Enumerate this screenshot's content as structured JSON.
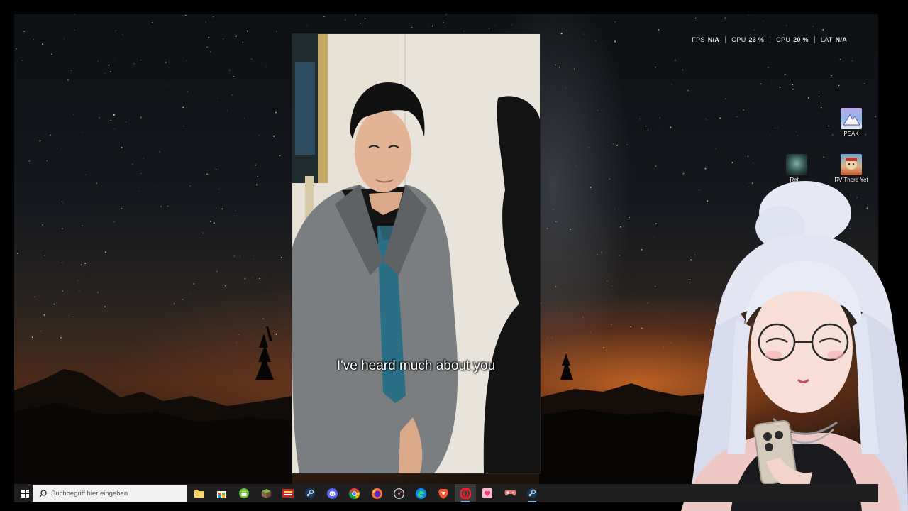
{
  "perf_overlay": {
    "fps": {
      "label": "FPS",
      "value": "N/A"
    },
    "gpu": {
      "label": "GPU",
      "value": "23 %"
    },
    "cpu": {
      "label": "CPU",
      "value": "20 %"
    },
    "lat": {
      "label": "LAT",
      "value": "N/A"
    }
  },
  "video": {
    "subtitle": "I've heard much about you"
  },
  "desktop_icons": {
    "peak": {
      "label": "PEAK"
    },
    "rv_there_yet": {
      "label": "RV There Yet"
    },
    "ret": {
      "label": "Ret..."
    }
  },
  "taskbar": {
    "search_placeholder": "Suchbegriff hier eingeben",
    "app_icons": [
      "file-explorer-icon",
      "microsoft-store-icon",
      "android-icon",
      "minecraft-icon",
      "app-badge-icon",
      "steam-icon",
      "discord-icon",
      "chrome-icon",
      "firefox-icon",
      "speedometer-icon",
      "edge-icon",
      "brave-icon",
      "opera-icon",
      "pink-app-icon",
      "game-controller-icon",
      "steam-icon"
    ],
    "colors": {
      "background": "#1f1f1f",
      "search_box": "#f2f2f2",
      "active_indicator": "#8ab4f8"
    }
  }
}
